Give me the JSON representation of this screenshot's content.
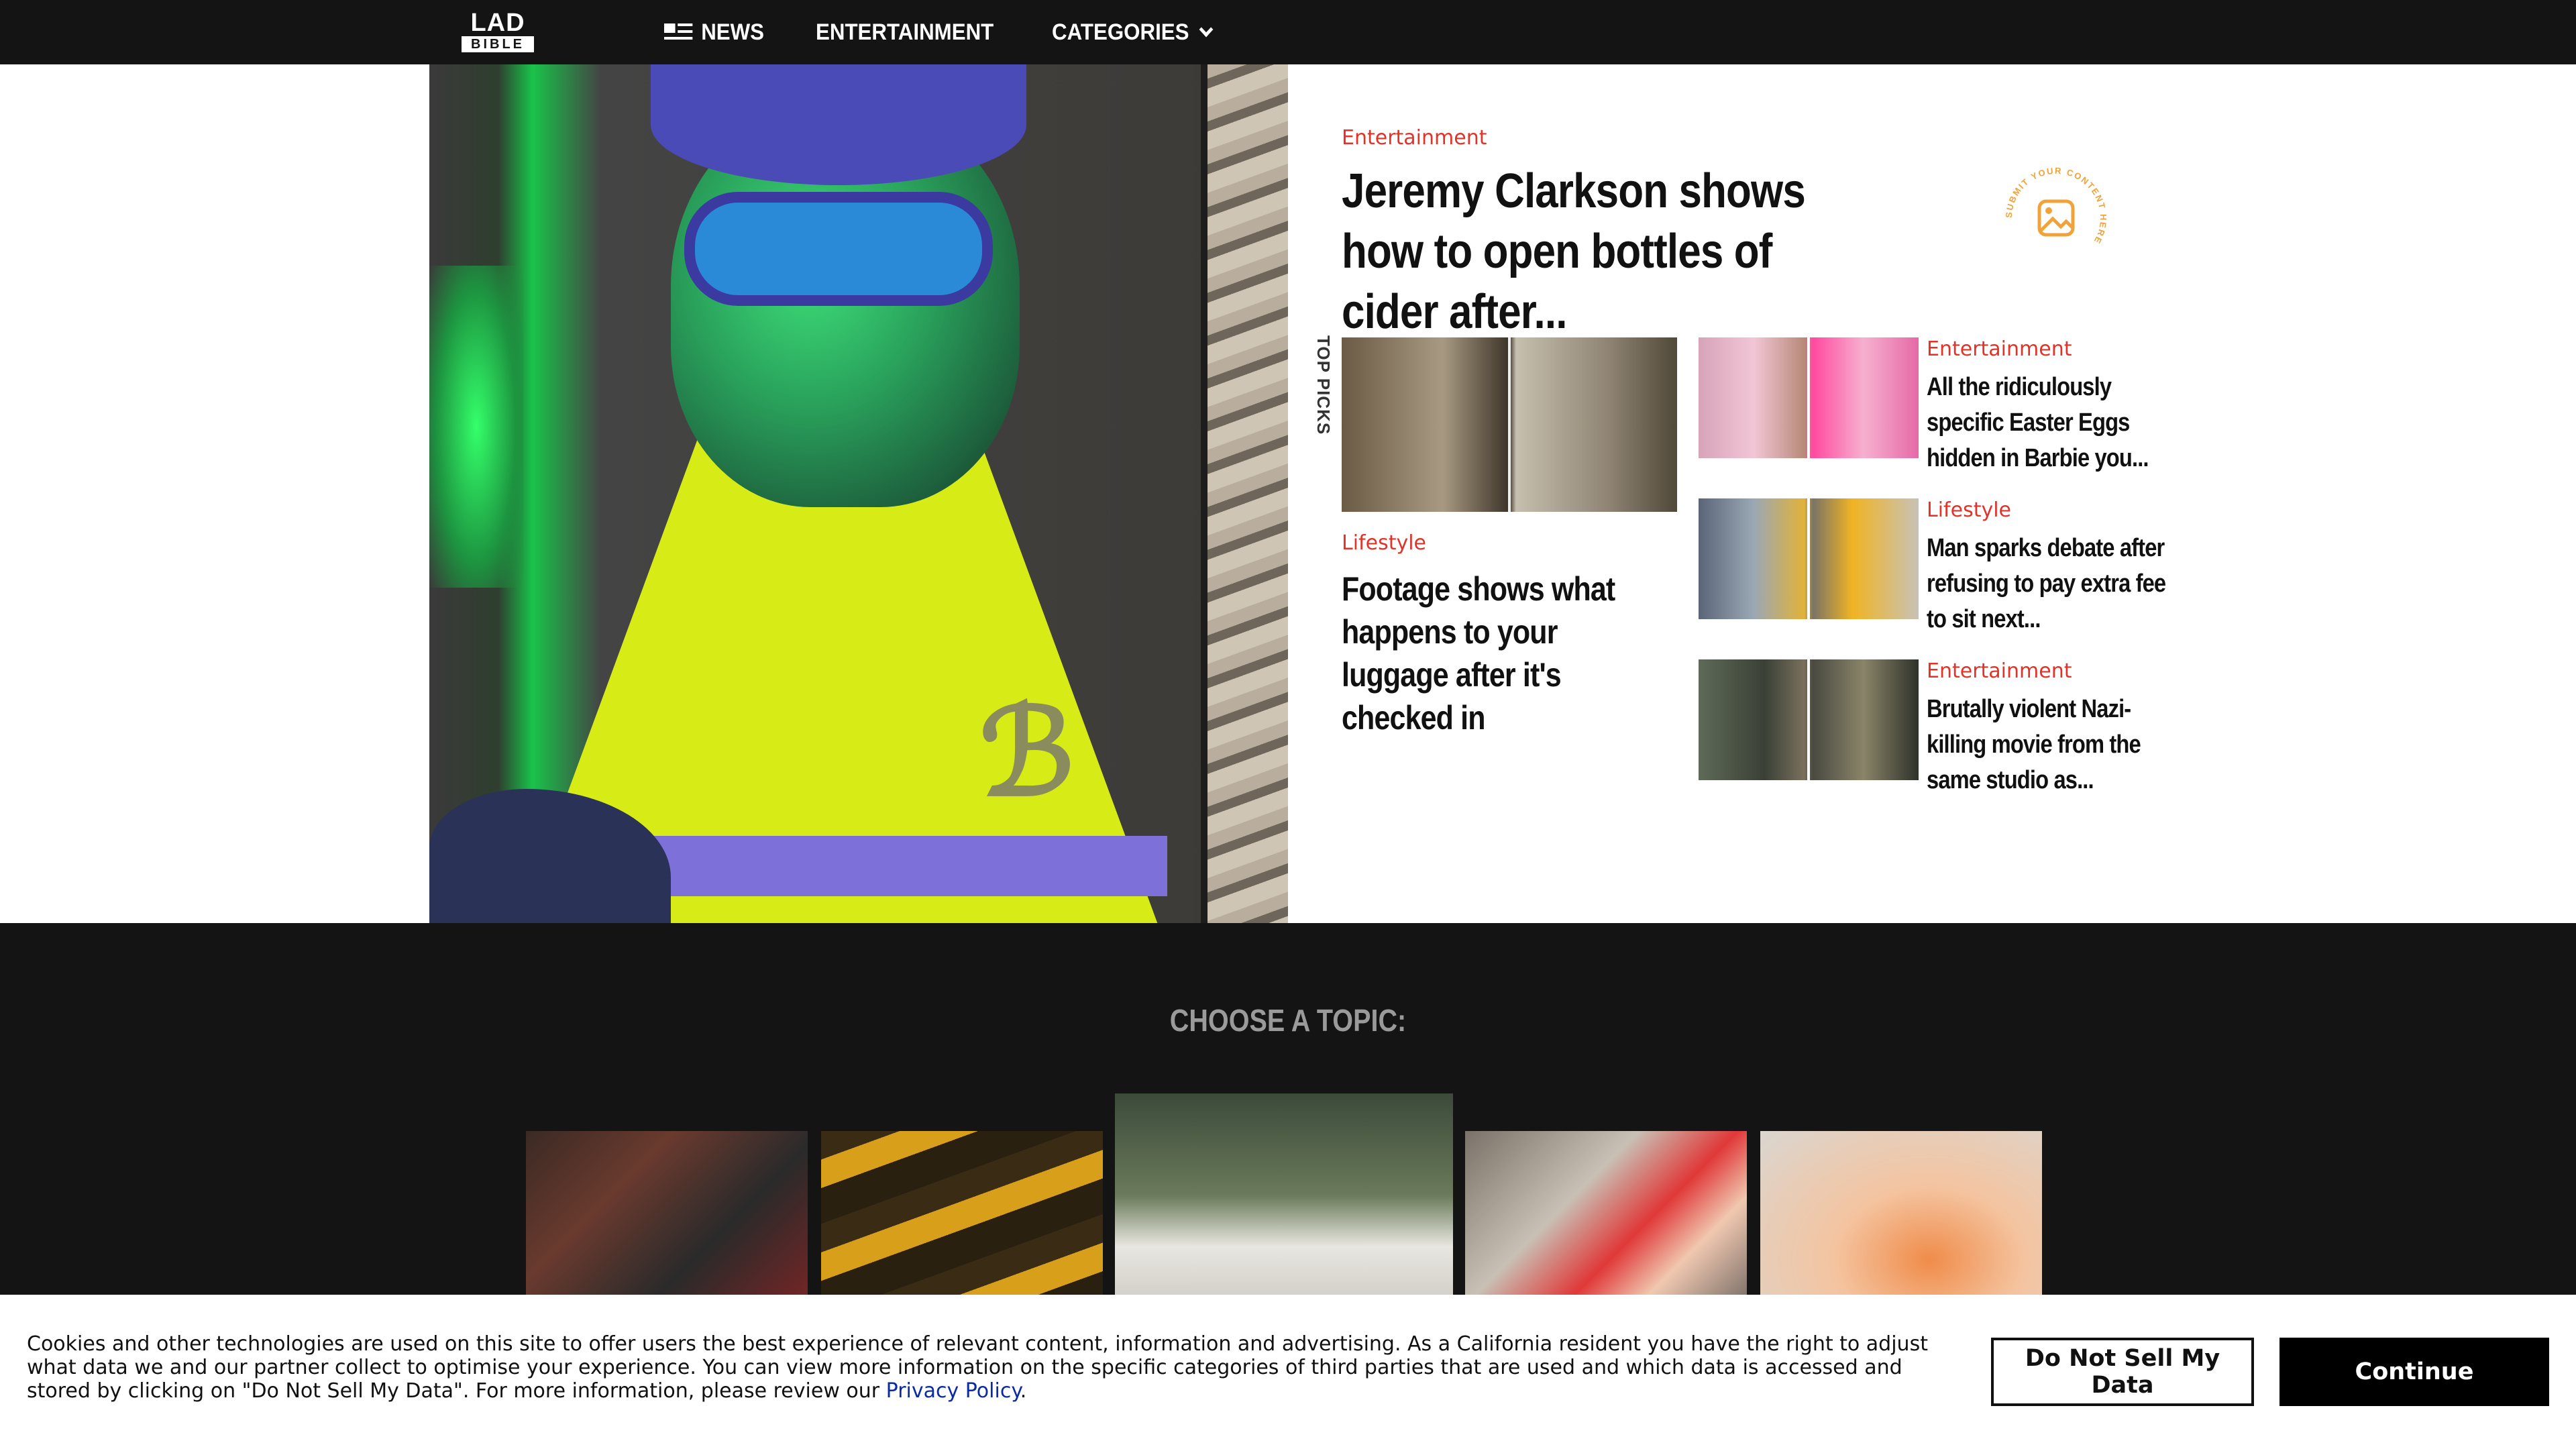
{
  "brand": {
    "logo_top": "LAD",
    "logo_bottom": "BIBLE"
  },
  "nav": {
    "items": [
      {
        "label": "NEWS",
        "icon": "news-icon"
      },
      {
        "label": "ENTERTAINMENT"
      },
      {
        "label": "CATEGORIES",
        "icon": "chevron-down-icon"
      }
    ]
  },
  "hero": {
    "category": "Entertainment",
    "title": "Jeremy Clarkson shows how to open bottles of cider after...",
    "badge_text": "SUBMIT YOUR CONTENT HERE"
  },
  "top_picks": {
    "label": "TOP PICKS",
    "main": {
      "category": "Lifestyle",
      "title": "Footage shows what happens to your luggage after it's checked in"
    },
    "items": [
      {
        "category": "Entertainment",
        "title": "All the ridiculously specific Easter Eggs hidden in Barbie you..."
      },
      {
        "category": "Lifestyle",
        "title": "Man sparks debate after refusing to pay extra fee to sit next..."
      },
      {
        "category": "Entertainment",
        "title": "Brutally violent Nazi-killing movie from the same studio as..."
      }
    ]
  },
  "topics": {
    "title": "CHOOSE A TOPIC:"
  },
  "cookie": {
    "text": "Cookies and other technologies are used on this site to offer users the best experience of relevant content, information and advertising. As a California resident you have the right to adjust what data we and our partner collect to optimise your experience. You can view more information on the specific categories of third parties that are used and which data is accessed and stored by clicking on \"Do Not Sell My Data\". For more information, please review our ",
    "link_label": "Privacy Policy",
    "suffix": ".",
    "dns_label": "Do Not Sell My Data",
    "continue_label": "Continue"
  },
  "colors": {
    "accent": "#e0342a",
    "nav_bg": "#141414",
    "badge": "#f0a33a",
    "link": "#0b2aa6"
  }
}
